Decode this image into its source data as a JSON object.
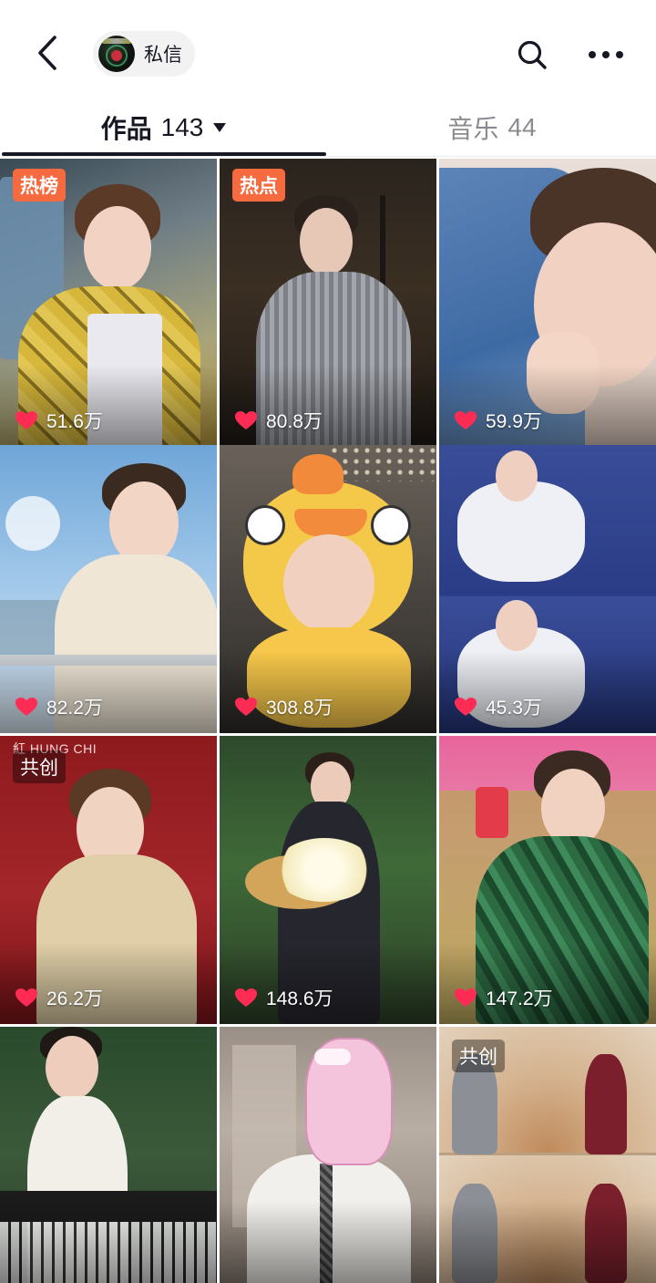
{
  "header": {
    "back_icon": "chevron-left-icon",
    "dm_label": "私信",
    "search_icon": "search-icon",
    "more_icon": "ellipsis-icon"
  },
  "tabs": [
    {
      "label": "作品",
      "count": "143",
      "active": true,
      "has_dropdown": true
    },
    {
      "label": "音乐",
      "count": "44",
      "active": false
    }
  ],
  "colors": {
    "hot_badge": "#f56a3e",
    "like_heart": "#fe2c55",
    "active_tab": "#161823",
    "inactive_tab": "#8a8b91"
  },
  "videos": [
    {
      "badge": "热榜",
      "badge_type": "hot",
      "likes": "51.6万"
    },
    {
      "badge": "热点",
      "badge_type": "hot",
      "likes": "80.8万"
    },
    {
      "badge": "",
      "badge_type": "none",
      "likes": "59.9万"
    },
    {
      "badge": "",
      "badge_type": "none",
      "likes": "82.2万"
    },
    {
      "badge": "",
      "badge_type": "none",
      "likes": "308.8万"
    },
    {
      "badge": "",
      "badge_type": "none",
      "likes": "45.3万"
    },
    {
      "badge": "共创",
      "badge_type": "co",
      "likes": "26.2万",
      "logo_text": "紅 HUNG CHI"
    },
    {
      "badge": "",
      "badge_type": "none",
      "likes": "148.6万"
    },
    {
      "badge": "",
      "badge_type": "none",
      "likes": "147.2万"
    },
    {
      "badge": "",
      "badge_type": "none",
      "likes": ""
    },
    {
      "badge": "",
      "badge_type": "none",
      "likes": ""
    },
    {
      "badge": "共创",
      "badge_type": "co",
      "likes": ""
    }
  ]
}
